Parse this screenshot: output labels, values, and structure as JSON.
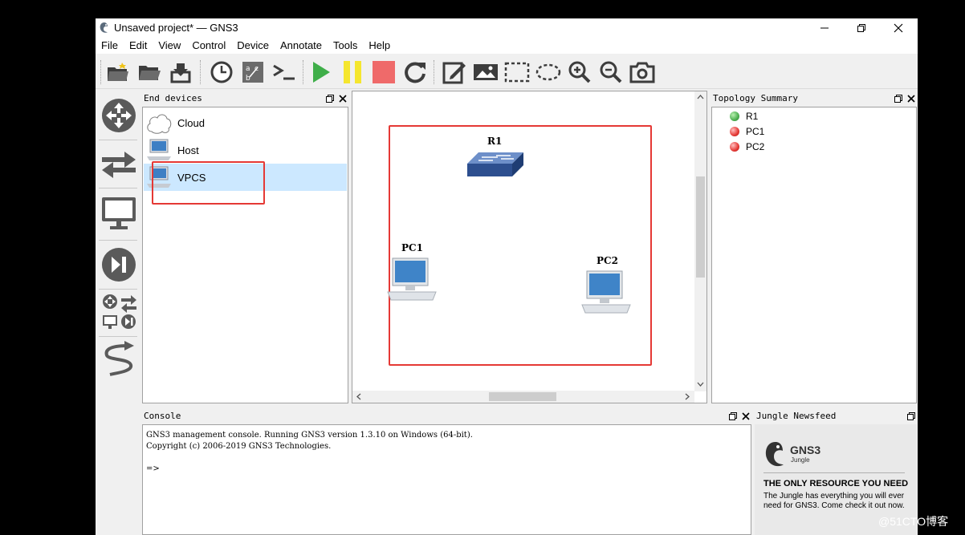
{
  "window": {
    "title": "Unsaved project* — GNS3"
  },
  "menu": [
    "File",
    "Edit",
    "View",
    "Control",
    "Device",
    "Annotate",
    "Tools",
    "Help"
  ],
  "toolbar": {
    "buttons": [
      "new-project",
      "open-project",
      "save-project",
      "snapshot",
      "show-interface-labels",
      "console-all",
      "start-all",
      "suspend-all",
      "stop-all",
      "reload-all",
      "add-note",
      "insert-picture",
      "draw-rectangle",
      "draw-ellipse",
      "zoom-in",
      "zoom-out",
      "screenshot"
    ]
  },
  "end_devices": {
    "title": "End devices",
    "items": [
      {
        "label": "Cloud",
        "selected": false
      },
      {
        "label": "Host",
        "selected": false
      },
      {
        "label": "VPCS",
        "selected": true
      }
    ]
  },
  "canvas": {
    "nodes": [
      {
        "id": "R1",
        "label": "R1",
        "kind": "switch"
      },
      {
        "id": "PC1",
        "label": "PC1",
        "kind": "pc"
      },
      {
        "id": "PC2",
        "label": "PC2",
        "kind": "pc"
      }
    ]
  },
  "topology": {
    "title": "Topology Summary",
    "items": [
      {
        "label": "R1",
        "status_color": "#4caf50"
      },
      {
        "label": "PC1",
        "status_color": "#e53935"
      },
      {
        "label": "PC2",
        "status_color": "#e53935"
      }
    ]
  },
  "console": {
    "title": "Console",
    "line1": "GNS3 management console. Running GNS3 version 1.3.10 on Windows (64-bit).",
    "line2": "Copyright (c) 2006-2019 GNS3 Technologies.",
    "prompt": "=>"
  },
  "newsfeed": {
    "title": "Jungle Newsfeed",
    "logo_text": "GNS3",
    "logo_sub": "Jungle",
    "headline": "THE ONLY RESOURCE YOU NEED",
    "body": "The Jungle has everything you will ever need for GNS3. Come check it out now."
  },
  "watermark": "@51CTO博客",
  "colors": {
    "highlight": "#e53935",
    "selection": "#cce8ff"
  }
}
